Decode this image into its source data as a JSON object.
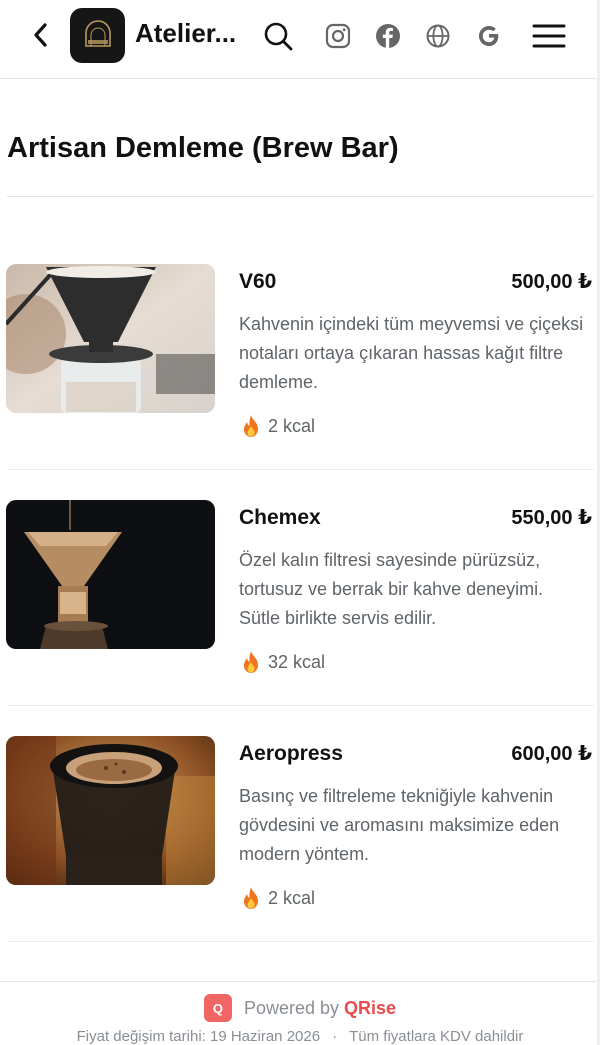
{
  "header": {
    "brand_name": "Atelier...",
    "icons": [
      "back-icon",
      "logo",
      "search-icon",
      "instagram-icon",
      "facebook-icon",
      "globe-icon",
      "google-icon",
      "menu-icon"
    ]
  },
  "page": {
    "title": "Artisan Demleme (Brew Bar)"
  },
  "items": [
    {
      "name": "V60",
      "price": "500,00 ₺",
      "description": "Kahvenin içindeki tüm meyvemsi ve çiçeksi notaları ortaya çıkaran hassas kağıt filtre demleme.",
      "kcal": "2 kcal"
    },
    {
      "name": "Chemex",
      "price": "550,00 ₺",
      "description": "Özel kalın filtresi sayesinde pürüzsüz, tortusuz ve berrak bir kahve deneyimi. Sütle birlikte servis edilir.",
      "kcal": "32 kcal"
    },
    {
      "name": "Aeropress",
      "price": "600,00 ₺",
      "description": "Basınç ve filtreleme tekniğiyle kahvenin gövdesini ve aromasını maksimize eden modern yöntem.",
      "kcal": "2 kcal"
    }
  ],
  "footer": {
    "badge": "Q",
    "powered_by": "Powered by",
    "brand": "QRise",
    "price_change": "Fiyat değişim tarihi: 19 Haziran 2026",
    "separator": "·",
    "vat_note": "Tüm fiyatlara KDV dahildir"
  },
  "colors": {
    "accent": "#ea4b4b",
    "text": "#111111",
    "muted": "#5f6468"
  }
}
